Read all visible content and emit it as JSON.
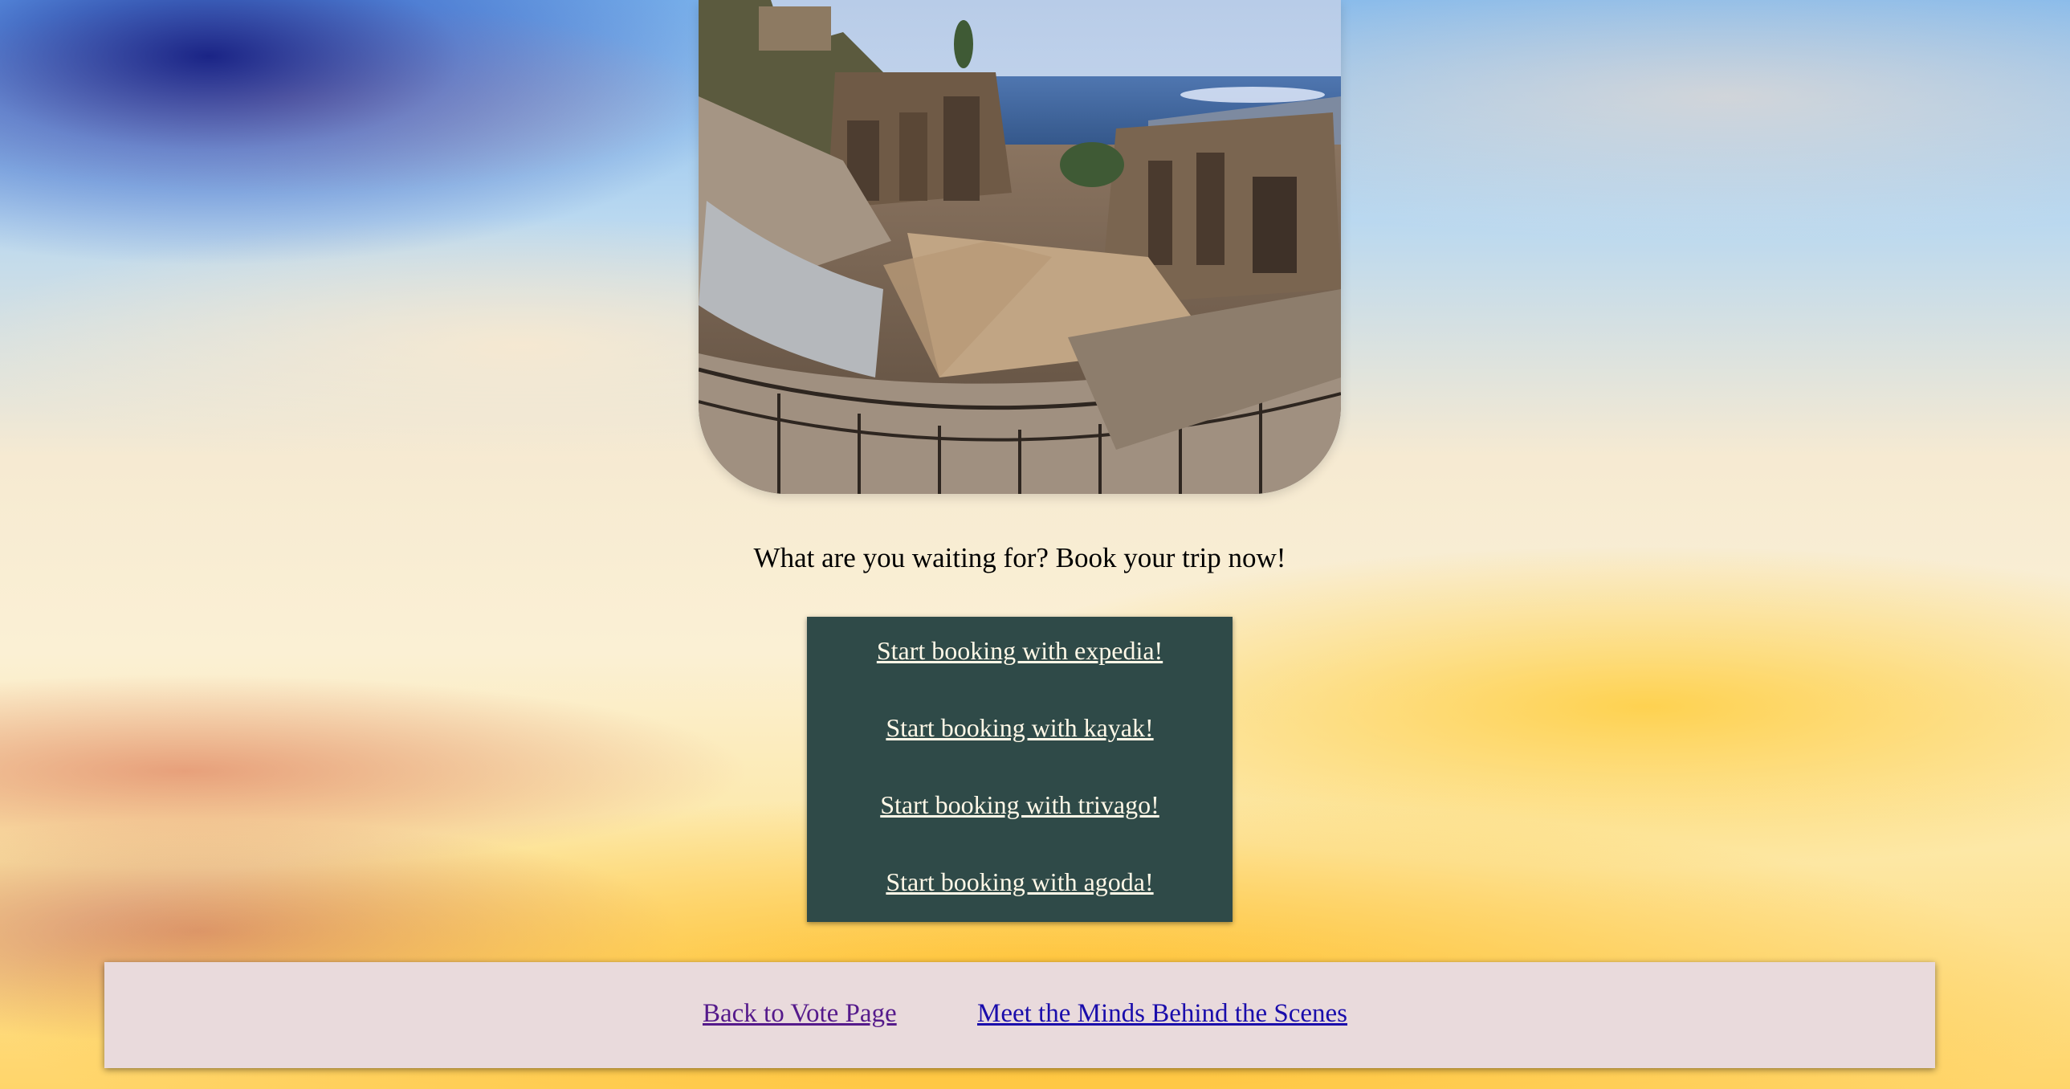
{
  "hero": {
    "image_name": "ancient-greek-theatre-photo"
  },
  "cta": {
    "text": "What are you waiting for? Book your trip now!"
  },
  "booking": {
    "links": [
      {
        "label": "Start booking with expedia!"
      },
      {
        "label": "Start booking with kayak!"
      },
      {
        "label": "Start booking with trivago!"
      },
      {
        "label": "Start booking with agoda!"
      }
    ],
    "background_color": "#2f4a48",
    "link_color": "#fff8e7"
  },
  "footer": {
    "back_label": "Back to Vote Page",
    "minds_label": "Meet the Minds Behind the Scenes",
    "background_color": "#e9dadc"
  }
}
